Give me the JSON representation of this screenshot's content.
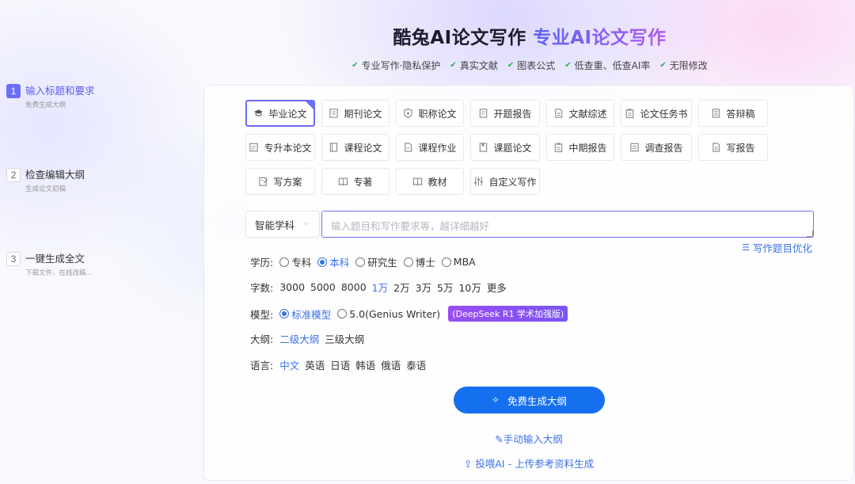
{
  "header": {
    "title_main": "酷兔AI论文写作",
    "title_highlight": "专业AI论文写作",
    "features": [
      "专业写作·隐私保护",
      "真实文献",
      "图表公式",
      "低查重、低查AI率",
      "无限修改"
    ]
  },
  "steps": [
    {
      "num": "1",
      "title": "输入标题和要求",
      "sub": "免费生成大纲"
    },
    {
      "num": "2",
      "title": "检查编辑大纲",
      "sub": "生成论文初稿"
    },
    {
      "num": "3",
      "title": "一键生成全文",
      "sub": "下载文件、在线改稿..."
    }
  ],
  "paper_types": [
    {
      "label": "毕业论文",
      "icon": "graduation-cap-icon",
      "selected": true
    },
    {
      "label": "期刊论文",
      "icon": "journal-icon"
    },
    {
      "label": "职称论文",
      "icon": "shield-icon"
    },
    {
      "label": "开题报告",
      "icon": "document-icon"
    },
    {
      "label": "文献综述",
      "icon": "document-icon"
    },
    {
      "label": "论文任务书",
      "icon": "clipboard-icon"
    },
    {
      "label": "答辩稿",
      "icon": "document-icon"
    },
    {
      "label": "专升本论文",
      "icon": "document-icon"
    },
    {
      "label": "课程论文",
      "icon": "book-icon"
    },
    {
      "label": "课程作业",
      "icon": "document-icon"
    },
    {
      "label": "课题论文",
      "icon": "bookmark-icon"
    },
    {
      "label": "中期报告",
      "icon": "clipboard-icon"
    },
    {
      "label": "调查报告",
      "icon": "chart-icon"
    },
    {
      "label": "写报告",
      "icon": "document-icon"
    },
    {
      "label": "写方案",
      "icon": "edit-icon"
    },
    {
      "label": "专著",
      "icon": "book-icon"
    },
    {
      "label": "教材",
      "icon": "book-icon"
    },
    {
      "label": "自定义写作",
      "icon": "sliders-icon"
    }
  ],
  "subject_select": "智能学科",
  "topic_placeholder": "输入题目和写作要求等，越详细越好",
  "optimize_label": "写作题目优化",
  "education": {
    "label": "学历:",
    "options": [
      "专科",
      "本科",
      "研究生",
      "博士",
      "MBA"
    ],
    "selected": "本科"
  },
  "word_count": {
    "label": "字数:",
    "options": [
      "3000",
      "5000",
      "8000",
      "1万",
      "2万",
      "3万",
      "5万",
      "10万",
      "更多"
    ],
    "selected": "1万"
  },
  "model": {
    "label": "模型:",
    "options": [
      "标准模型",
      "5.0(Genius Writer)"
    ],
    "selected": "标准模型",
    "badge": "(DeepSeek R1 学术加强版)"
  },
  "outline": {
    "label": "大纲:",
    "options": [
      "二级大纲",
      "三级大纲"
    ],
    "selected": "二级大纲"
  },
  "language": {
    "label": "语言:",
    "options": [
      "中文",
      "英语",
      "日语",
      "韩语",
      "俄语",
      "泰语"
    ],
    "selected": "中文"
  },
  "generate_button": "免费生成大纲",
  "manual_link": "手动输入大纲",
  "upload_link": "投喂AI - 上传参考资料生成",
  "colors": {
    "accent": "#6b6ef9",
    "primary_blue": "#1570ef",
    "link": "#3a72e8",
    "check": "#27b35a"
  }
}
